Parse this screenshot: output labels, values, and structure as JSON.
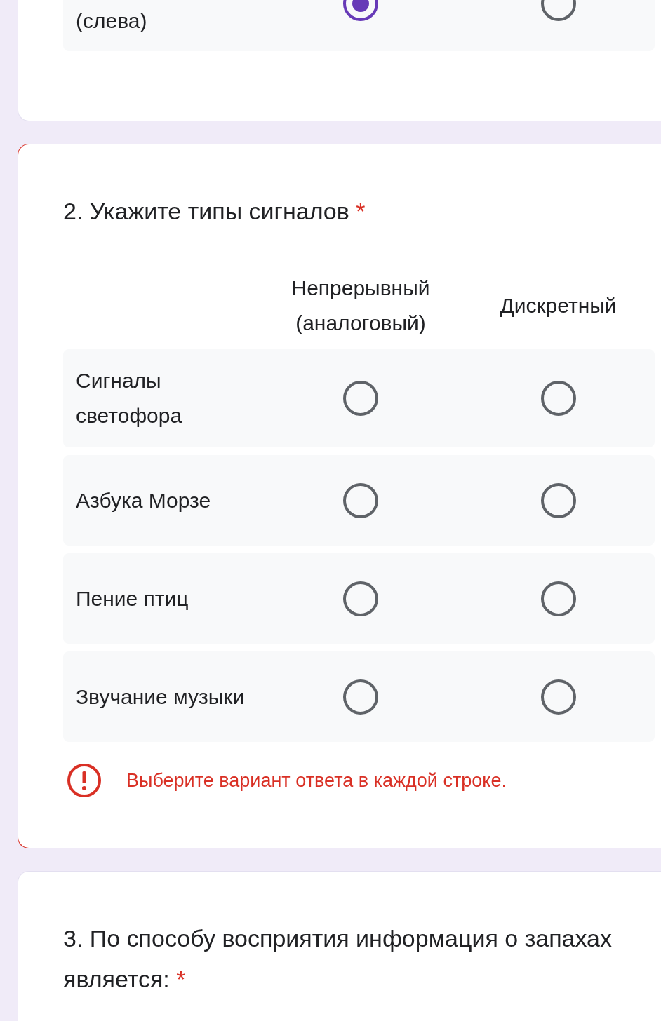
{
  "questions": [
    {
      "kind": "grid",
      "rows": [
        {
          "label": "(слева)",
          "choices": [
            {
              "selected": true
            },
            {
              "selected": false
            }
          ]
        }
      ]
    },
    {
      "kind": "grid",
      "title": "2. Укажите типы сигналов",
      "required_mark": "*",
      "columns": [
        "Непрерывный (аналоговый)",
        "Дискретный"
      ],
      "rows": [
        {
          "label": "Сигналы светофора",
          "choices": [
            {
              "selected": false
            },
            {
              "selected": false
            }
          ]
        },
        {
          "label": "Азбука Морзе",
          "choices": [
            {
              "selected": false
            },
            {
              "selected": false
            }
          ]
        },
        {
          "label": "Пение птиц",
          "choices": [
            {
              "selected": false
            },
            {
              "selected": false
            }
          ]
        },
        {
          "label": "Звучание музыки",
          "choices": [
            {
              "selected": false
            },
            {
              "selected": false
            }
          ]
        }
      ],
      "error": "Выберите вариант ответа в каждой строке."
    },
    {
      "kind": "text",
      "title": "3. По способу восприятия информация о запахах является:",
      "required_mark": "*"
    }
  ]
}
